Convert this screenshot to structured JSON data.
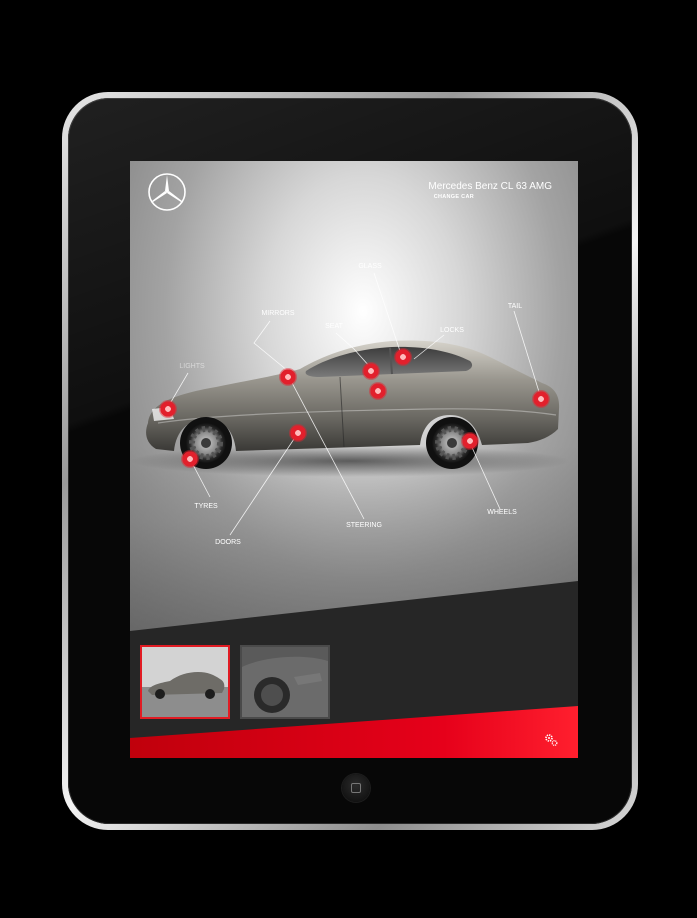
{
  "app": {
    "model_name": "Mercedes Benz CL 63 AMG",
    "change_car_label": "CHANGE CAR",
    "brand_logo": "mercedes-star-icon",
    "settings_icon": "gear-icon",
    "accent_color": "#e6001a"
  },
  "hotspots": {
    "glass": "GLASS",
    "mirrors": "MIRRORS",
    "seat": "SEAT",
    "locks": "LOCKS",
    "tail": "TAIL",
    "lights": "LIGHTS",
    "tyres": "TYRES",
    "doors": "DOORS",
    "steering": "STEERING",
    "wheels": "WHEELS"
  },
  "thumbnails": [
    {
      "name": "side-view",
      "selected": true
    },
    {
      "name": "front-detail",
      "selected": false
    }
  ]
}
